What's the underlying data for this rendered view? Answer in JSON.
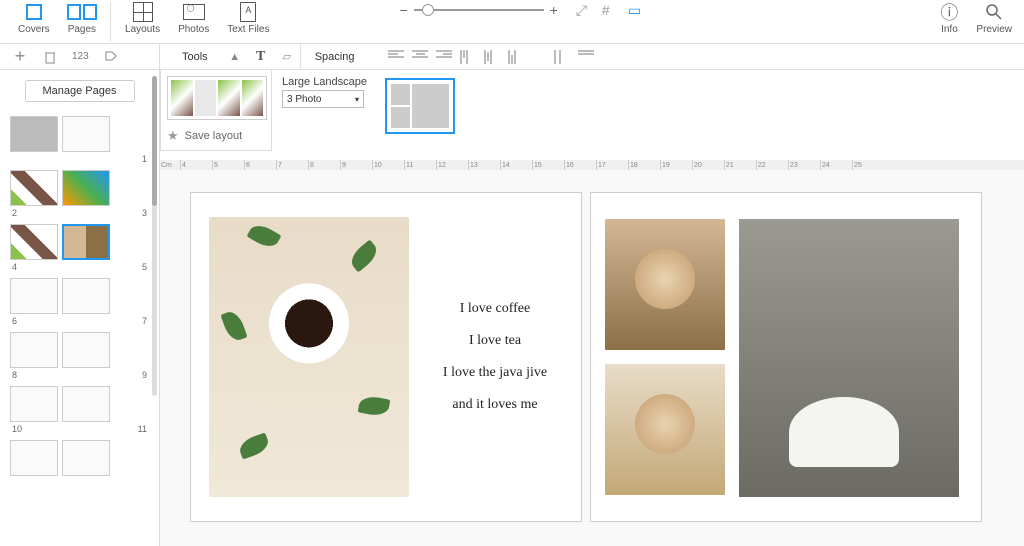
{
  "topbar": {
    "covers": "Covers",
    "pages": "Pages",
    "layouts": "Layouts",
    "photos": "Photos",
    "textfiles": "Text Files",
    "info": "Info",
    "preview": "Preview"
  },
  "toolbar2": {
    "tools": "Tools",
    "spacing": "Spacing"
  },
  "sidebar": {
    "page_count": "123",
    "manage": "Manage Pages",
    "page_numbers": [
      "1",
      "2",
      "3",
      "4",
      "5",
      "6",
      "7",
      "8",
      "9",
      "10",
      "11"
    ]
  },
  "layout_panel": {
    "save": "Save layout"
  },
  "layout_selector": {
    "label": "Large Landscape",
    "value": "3 Photo"
  },
  "ruler": [
    "Cm",
    "4",
    "5",
    "6",
    "7",
    "8",
    "9",
    "10",
    "11",
    "12",
    "13",
    "14",
    "15",
    "16",
    "17",
    "18",
    "19",
    "20",
    "21",
    "22",
    "23",
    "24",
    "25"
  ],
  "spread_text": {
    "l1": "I love coffee",
    "l2": "I love tea",
    "l3": "I love the java jive",
    "l4": "and it loves me"
  }
}
